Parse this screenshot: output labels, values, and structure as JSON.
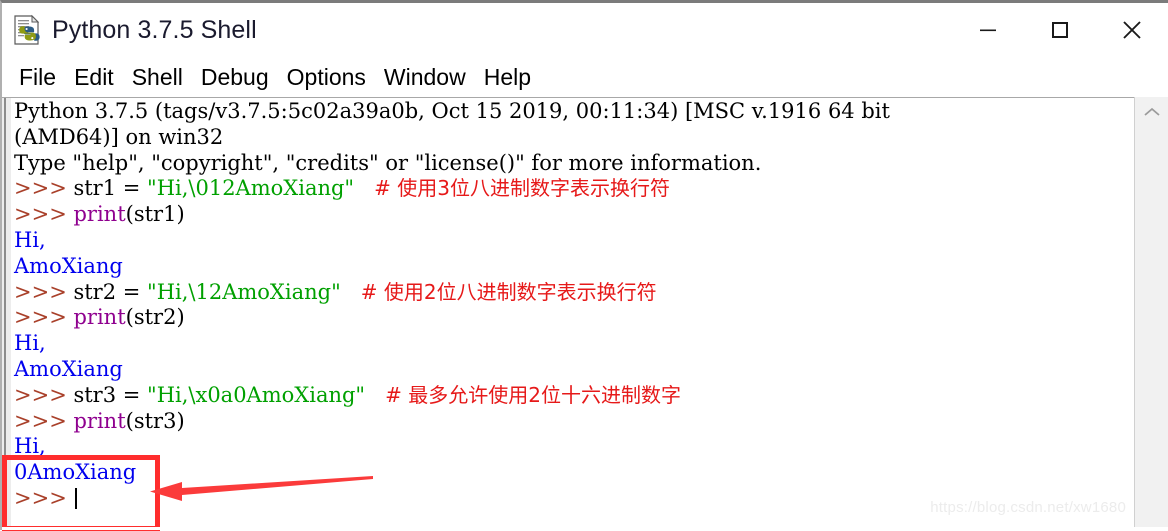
{
  "window": {
    "title": "Python 3.7.5 Shell",
    "icon": "python-file-icon",
    "controls": {
      "minimize": "minimize-icon",
      "maximize": "maximize-icon",
      "close": "close-icon"
    }
  },
  "menubar": {
    "items": [
      {
        "label": "File"
      },
      {
        "label": "Edit"
      },
      {
        "label": "Shell"
      },
      {
        "label": "Debug"
      },
      {
        "label": "Options"
      },
      {
        "label": "Window"
      },
      {
        "label": "Help"
      }
    ]
  },
  "shell": {
    "lines": [
      {
        "segments": [
          {
            "text": "Python 3.7.5 (tags/v3.7.5:5c02a39a0b, Oct 15 2019, 00:11:34) [MSC v.1916 64 bit",
            "style": "plain"
          }
        ]
      },
      {
        "segments": [
          {
            "text": "(AMD64)] on win32",
            "style": "plain"
          }
        ]
      },
      {
        "segments": [
          {
            "text": "Type \"help\", \"copyright\", \"credits\" or \"license()\" for more information.",
            "style": "plain"
          }
        ]
      },
      {
        "segments": [
          {
            "text": ">>> ",
            "style": "prompt"
          },
          {
            "text": "str1 = ",
            "style": "plain"
          },
          {
            "text": "\"Hi,\\012AmoXiang\"",
            "style": "string"
          },
          {
            "text": "   ",
            "style": "plain"
          },
          {
            "text": "# 使用3位八进制数字表示换行符",
            "style": "comment"
          }
        ]
      },
      {
        "segments": [
          {
            "text": ">>> ",
            "style": "prompt"
          },
          {
            "text": "print",
            "style": "builtin"
          },
          {
            "text": "(str1)",
            "style": "plain"
          }
        ]
      },
      {
        "segments": [
          {
            "text": "Hi,",
            "style": "output"
          }
        ]
      },
      {
        "segments": [
          {
            "text": "AmoXiang",
            "style": "output"
          }
        ]
      },
      {
        "segments": [
          {
            "text": ">>> ",
            "style": "prompt"
          },
          {
            "text": "str2 = ",
            "style": "plain"
          },
          {
            "text": "\"Hi,\\12AmoXiang\"",
            "style": "string"
          },
          {
            "text": "   ",
            "style": "plain"
          },
          {
            "text": "# 使用2位八进制数字表示换行符",
            "style": "comment"
          }
        ]
      },
      {
        "segments": [
          {
            "text": ">>> ",
            "style": "prompt"
          },
          {
            "text": "print",
            "style": "builtin"
          },
          {
            "text": "(str2)",
            "style": "plain"
          }
        ]
      },
      {
        "segments": [
          {
            "text": "Hi,",
            "style": "output"
          }
        ]
      },
      {
        "segments": [
          {
            "text": "AmoXiang",
            "style": "output"
          }
        ]
      },
      {
        "segments": [
          {
            "text": ">>> ",
            "style": "prompt"
          },
          {
            "text": "str3 = ",
            "style": "plain"
          },
          {
            "text": "\"Hi,\\x0a0AmoXiang\"",
            "style": "string"
          },
          {
            "text": "   ",
            "style": "plain"
          },
          {
            "text": "# 最多允许使用2位十六进制数字",
            "style": "comment"
          }
        ]
      },
      {
        "segments": [
          {
            "text": ">>> ",
            "style": "prompt"
          },
          {
            "text": "print",
            "style": "builtin"
          },
          {
            "text": "(str3)",
            "style": "plain"
          }
        ]
      },
      {
        "segments": [
          {
            "text": "Hi,",
            "style": "output"
          }
        ]
      },
      {
        "segments": [
          {
            "text": "0AmoXiang",
            "style": "output"
          }
        ]
      },
      {
        "segments": [
          {
            "text": ">>> ",
            "style": "prompt"
          },
          {
            "text": "",
            "style": "caret"
          }
        ]
      }
    ]
  },
  "scrollbar": {
    "up_arrow": "chevron-up-icon"
  },
  "annotations": {
    "highlight_box": {
      "label": "red-highlight-box"
    },
    "arrow": {
      "label": "red-pointer-arrow"
    }
  },
  "watermark": {
    "text": "https://blog.csdn.net/xw1680"
  },
  "colors": {
    "prompt": "#a9402a",
    "string": "#00a000",
    "builtin": "#8f008f",
    "output": "#0000ee",
    "comment": "#e61919",
    "annotation": "#ff2d2d",
    "title_text": "#1a1a2e"
  }
}
